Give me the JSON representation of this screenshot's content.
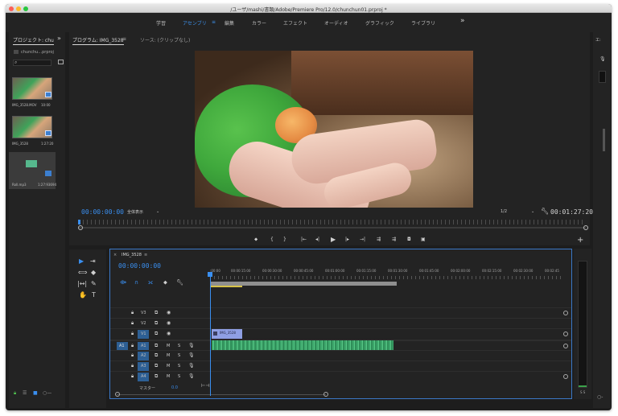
{
  "window": {
    "title": "/ユーザ/mashi/書類/Adobe/Premiere Pro/12.0/chunchun01.prproj *"
  },
  "workspaces": [
    {
      "label": "学習",
      "active": false
    },
    {
      "label": "アセンブリ",
      "active": true
    },
    {
      "label": "編集",
      "active": false
    },
    {
      "label": "カラー",
      "active": false
    },
    {
      "label": "エフェクト",
      "active": false
    },
    {
      "label": "オーディオ",
      "active": false
    },
    {
      "label": "グラフィック",
      "active": false
    },
    {
      "label": "ライブラリ",
      "active": false
    }
  ],
  "workspace_menu_icon": "≡",
  "workspace_more": "»",
  "project": {
    "tab_label": "プロジェクト: chu",
    "more": "»",
    "file": "chunchu...prproj",
    "clips": [
      {
        "name": "IMG_3528.MOV",
        "duration": "10:00"
      },
      {
        "name": "IMG_3528",
        "duration": "1:27:20"
      }
    ],
    "audio_clip": {
      "name": "Roll.mp3",
      "duration": "1:27:93694"
    }
  },
  "program": {
    "tab_label": "プログラム: IMG_3528",
    "menu_icon": "≡",
    "source_label": "ソース: (クリップなし)",
    "timecode": "00:00:00:00",
    "fit": "全体表示",
    "resolution": "1/2",
    "duration": "00:01:27:20",
    "add_label": "+",
    "transport_icons": [
      "⬥",
      "{",
      "}",
      "|←",
      "◂|",
      "▶",
      "|▸",
      "→|",
      "⇶",
      "⇶",
      "◘",
      "▣"
    ]
  },
  "right_strip": {
    "label": "エ:",
    "meter_label": "S S"
  },
  "tools": [
    "▶",
    "⇥",
    "⟺",
    "◆",
    "|↔|",
    "✎",
    "✋",
    "T"
  ],
  "timeline": {
    "tab_label": "IMG_3528",
    "menu_icon": "≡",
    "close_icon": "×",
    "timecode": "00:00:00:00",
    "ruler_labels": [
      ":00:00",
      "00:00:15:00",
      "00:00:30:00",
      "00:00:45:00",
      "00:01:00:00",
      "00:01:15:00",
      "00:01:30:00",
      "00:01:45:00",
      "00:02:00:00",
      "00:02:15:00",
      "00:02:30:00",
      "00:02:45"
    ],
    "video_tracks": [
      "V3",
      "V2",
      "V1"
    ],
    "audio_tracks": [
      "A1",
      "A2",
      "A3",
      "A4"
    ],
    "source_patch": "A1",
    "mute": "M",
    "solo": "S",
    "clip_video_label": "IMG_3528",
    "master_label": "マスター",
    "master_value": "0.0"
  }
}
